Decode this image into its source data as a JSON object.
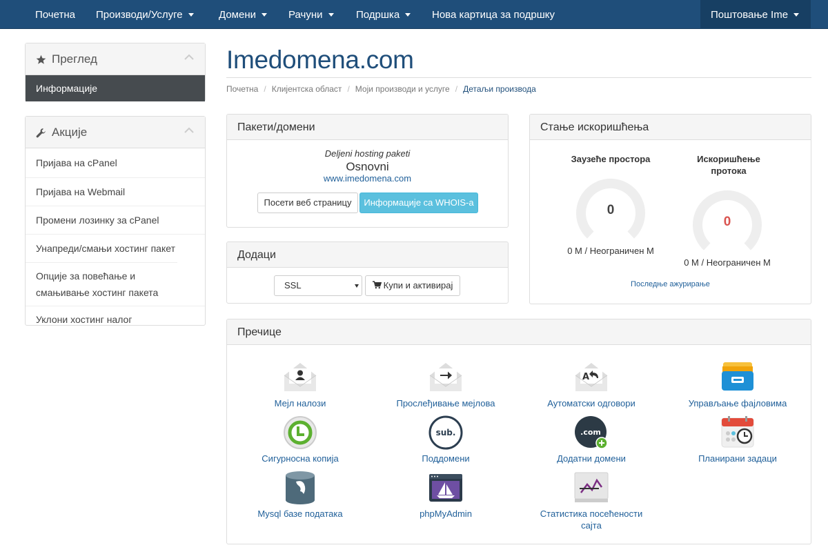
{
  "nav": {
    "items": [
      "Почетна",
      "Производи/Услуге",
      "Домени",
      "Рачуни",
      "Подршка",
      "Нова картица за подршку"
    ],
    "account": "Поштовање Ime"
  },
  "sidebar": {
    "overview_title": "Преглед",
    "overview_active": "Информације",
    "actions_title": "Акције",
    "actions": [
      "Пријава на cPanel",
      "Пријава на Webmail",
      "Промени лозинку за cPanel",
      "Унапреди/смањи хостинг пакет",
      "Опције за повећање и смањивање хостинг пакета",
      "Уклони хостинг налог"
    ]
  },
  "page": {
    "title": "Imedomena.com",
    "breadcrumb": [
      "Почетна",
      "Клијентска област",
      "Моји производи и услуге",
      "Детаљи производа"
    ]
  },
  "package": {
    "header": "Пакети/домени",
    "type": "Deljeni hosting paketi",
    "name": "Osnovni",
    "domain": "www.imedomena.com",
    "visit_button": "Посети веб страницу",
    "whois_button": "Информације са WHOIS-а"
  },
  "addons": {
    "header": "Додаци",
    "selected": "SSL",
    "buy_button": "Купи и активирај"
  },
  "usage": {
    "header": "Стање искоришћења",
    "disk_label": "Заузеће простора",
    "disk_value": "0",
    "disk_text": "0 M / Неограничен M",
    "bw_label": "Искоришћење протока",
    "bw_value": "0",
    "bw_text": "0 M / Неограничен M",
    "last_update": "Последње ажурирање",
    "colors": {
      "disk_value": "#444444",
      "bw_value": "#d9534f",
      "gauge_track": "#eeeeee"
    }
  },
  "shortcuts": {
    "header": "Пречице",
    "items": [
      {
        "label": "Мејл налози",
        "icon": "email-accounts-icon"
      },
      {
        "label": "Прослеђивање мејлова",
        "icon": "email-forward-icon"
      },
      {
        "label": "Аутоматски одговори",
        "icon": "autoresponder-icon"
      },
      {
        "label": "Управљање фајловима",
        "icon": "file-manager-icon"
      },
      {
        "label": "Сигурносна копија",
        "icon": "backup-icon"
      },
      {
        "label": "Поддомени",
        "icon": "subdomains-icon"
      },
      {
        "label": "Додатни домени",
        "icon": "addon-domains-icon"
      },
      {
        "label": "Планирани задаци",
        "icon": "cron-jobs-icon"
      },
      {
        "label": "Mysql базе података",
        "icon": "mysql-icon"
      },
      {
        "label": "phpMyAdmin",
        "icon": "phpmyadmin-icon"
      },
      {
        "label": "Статистика посећености сајта",
        "icon": "awstats-icon"
      }
    ]
  },
  "colors": {
    "nav_bg": "#1f4e7a",
    "link": "#1f5f99",
    "info_button": "#5bc0de"
  }
}
